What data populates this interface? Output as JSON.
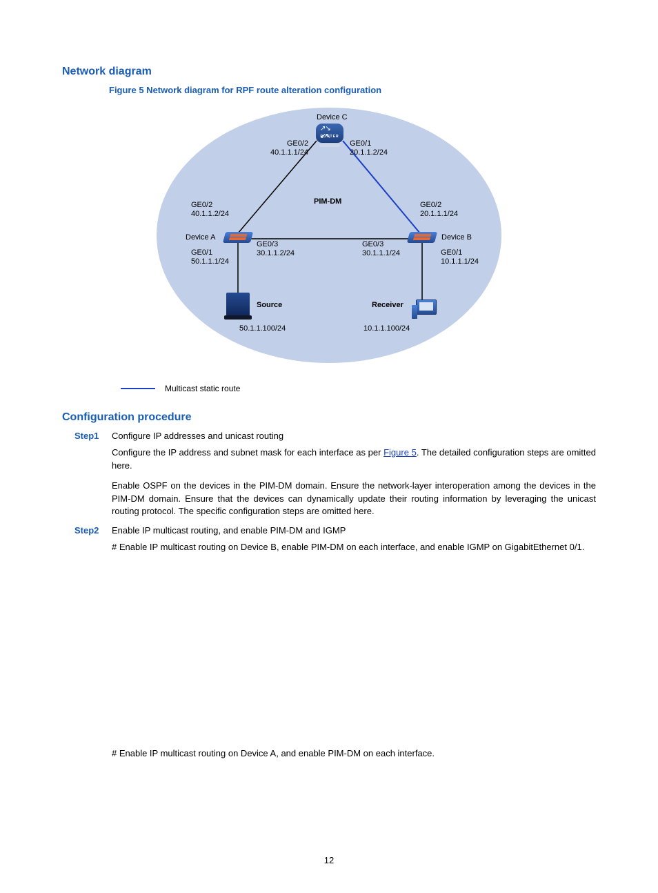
{
  "headings": {
    "network_diagram": "Network diagram",
    "figure_caption": "Figure 5 Network diagram for RPF route alteration configuration",
    "config_procedure": "Configuration procedure"
  },
  "diagram": {
    "device_c": "Device C",
    "device_a": "Device A",
    "device_b": "Device B",
    "pim_dm": "PIM-DM",
    "source": "Source",
    "receiver": "Receiver",
    "router_tag": "ROUTER",
    "c_ge02": "GE0/2",
    "c_ge02_ip": "40.1.1.1/24",
    "c_ge01": "GE0/1",
    "c_ge01_ip": "20.1.1.2/24",
    "a_ge02": "GE0/2",
    "a_ge02_ip": "40.1.1.2/24",
    "a_ge03": "GE0/3",
    "a_ge03_ip": "30.1.1.2/24",
    "a_ge01": "GE0/1",
    "a_ge01_ip": "50.1.1.1/24",
    "b_ge02": "GE0/2",
    "b_ge02_ip": "20.1.1.1/24",
    "b_ge03": "GE0/3",
    "b_ge03_ip": "30.1.1.1/24",
    "b_ge01": "GE0/1",
    "b_ge01_ip": "10.1.1.1/24",
    "source_ip": "50.1.1.100/24",
    "receiver_ip": "10.1.1.100/24"
  },
  "legend": {
    "multicast_static_route": "Multicast static route"
  },
  "steps": {
    "step1_label": "Step1",
    "step1_title": "Configure IP addresses and unicast routing",
    "step1_p1a": "Configure the IP address and subnet mask for each interface as per ",
    "step1_link": "Figure 5",
    "step1_p1b": ". The detailed configuration steps are omitted here.",
    "step1_p2": "Enable OSPF on the devices in the PIM-DM domain. Ensure the network-layer interoperation among the devices in the PIM-DM domain. Ensure that the devices can dynamically update their routing information by leveraging the unicast routing protocol. The specific configuration steps are omitted here.",
    "step2_label": "Step2",
    "step2_title": "Enable IP multicast routing, and enable PIM-DM and IGMP",
    "step2_p1": "# Enable IP multicast routing on Device B, enable PIM-DM on each interface, and enable IGMP on GigabitEthernet 0/1.",
    "step2_p2": "# Enable IP multicast routing on Device A, and enable PIM-DM on each interface."
  },
  "page_number": "12"
}
